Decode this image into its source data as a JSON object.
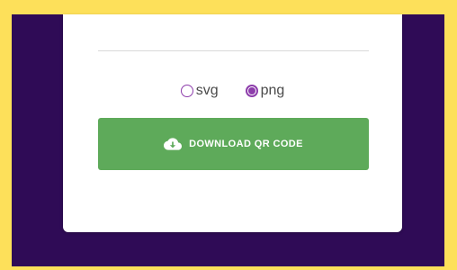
{
  "export_format": {
    "options": [
      {
        "label": "svg",
        "selected": false
      },
      {
        "label": "png",
        "selected": true
      }
    ]
  },
  "download_button": {
    "label": "DOWNLOAD QR CODE",
    "icon": "cloud-download-icon"
  },
  "colors": {
    "outer_frame": "#fde05a",
    "backdrop": "#2f0b56",
    "card": "#ffffff",
    "radio_accent": "#8d3dab",
    "button": "#5eaa5a"
  }
}
